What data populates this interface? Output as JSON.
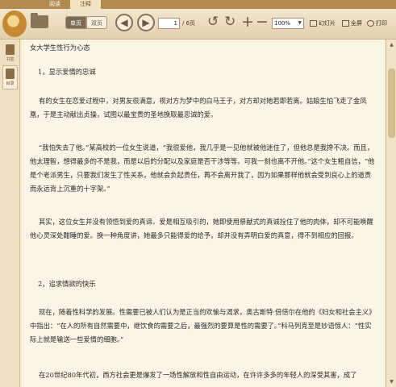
{
  "tabs": {
    "read": "阅读",
    "annotate": "注释"
  },
  "toolbar": {
    "single_page": "单页",
    "double_page": "双页",
    "page_current": "1",
    "page_total": "/ 6页",
    "zoom_value": "100%",
    "slideshow": "幻灯片",
    "fullscreen": "全屏",
    "print": "打印"
  },
  "sidebar": {
    "bookmark": "书签",
    "toc": "目录"
  },
  "document": {
    "title": "女大学生性行为心态",
    "h1": "1，显示爱情的忠诚",
    "p1": "有的女生在恋爱过程中，对男友很满意，视对方为梦中的白马王子，对方却对她若即若离。姑娘生怕飞走了金凤凰，于是主动献出贞操，试图以最宝贵的圣地换取最忠诚的爱。",
    "p2": "“我怕失去了他。”某高校的一位女生说道，“我很爱他，我几乎是一见他就被他迷住了，但他总是我搀不决。而且，他太理智，想得最多的不是我，而是以后的分配以及家庭是否干涉等等。可我一刻也离不开他。”这个女生粗自信，“他是个老派男生，只要我们发生了性关系，他就会负起责任，再不会离开我了，因为如果那样他就会受到良心上的道责而永远背上沉重的十字架。”",
    "p3": "其实，这位女生并没有领悟到爱的真谛。爱是相互吸引的，她即使用祭献式的真诚拴住了他的肉体，却不可能唤醒他心灵深处酣睡的爱。换一种角度讲，她最多只能得爱的给予，却并没有弄明白爱的真意，得不到相应的回报。",
    "h2": "2，追求情欲的快乐",
    "p4": "现在，随着性科学的发展。性需要已被人们认为是正当的欢愉与渴求，奥古斯特·倍倍尔在他的《妇女和社会主义》中指出：“在人的所有自然需要中，继饮食的需要之后，最强烈的要算是性的需要了。”科马列克至是妙语惊人：“性实际上就是输送一些爱情的细胞。”",
    "p5": "在20世纪80年代初，西方社会更是爆发了一场性解放和性自由运动，在许许多多的年轻人的深受其害，成了"
  }
}
